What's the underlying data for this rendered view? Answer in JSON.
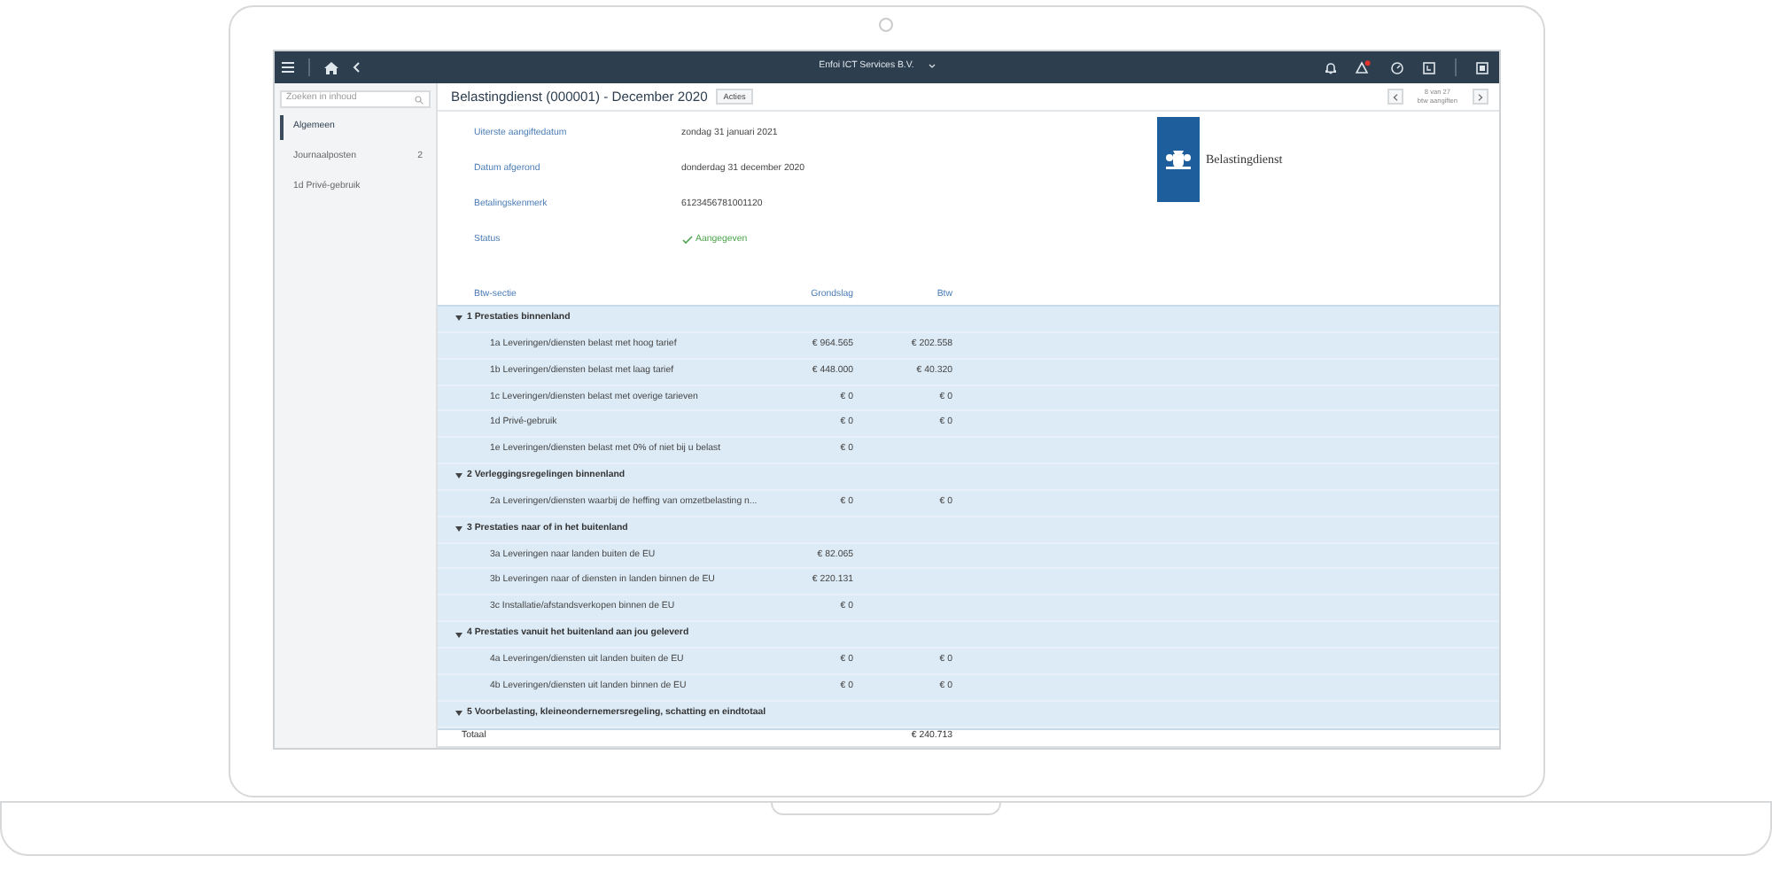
{
  "topbar": {
    "company": "Enfoi ICT Services B.V."
  },
  "sidebar": {
    "search": {
      "placeholder": "Zoeken in inhoud"
    },
    "items": [
      {
        "label": "Algemeen",
        "selected": true
      },
      {
        "label": "Journaalposten",
        "count": "2",
        "selected": false
      },
      {
        "label": "1d Privé-gebruik",
        "selected": false
      }
    ]
  },
  "header": {
    "title": "Belastingdienst (000001) - December 2020",
    "actions": "Acties",
    "pager": {
      "position": "8 van 27",
      "context": "btw aangiften"
    }
  },
  "details": [
    {
      "label": "Uiterste aangiftedatum",
      "value": "zondag 31 januari 2021",
      "kind": "text"
    },
    {
      "label": "Datum afgerond",
      "value": "donderdag 31 december 2020",
      "kind": "text"
    },
    {
      "label": "Betalingskenmerk",
      "value": "6123456781001120",
      "kind": "text"
    },
    {
      "label": "Status",
      "value": "Aangegeven",
      "kind": "status"
    }
  ],
  "logo": {
    "name": "Belastingdienst"
  },
  "table": {
    "columns": [
      "Btw-sectie",
      "Grondslag",
      "Btw"
    ],
    "groups": [
      {
        "label": "1 Prestaties binnenland",
        "expanded": true,
        "rows": [
          {
            "label": "1a Leveringen/diensten belast met hoog tarief",
            "base": "€ 964.565",
            "vat": "€ 202.558"
          },
          {
            "label": "1b Leveringen/diensten belast met laag tarief",
            "base": "€ 448.000",
            "vat": "€ 40.320"
          },
          {
            "label": "1c Leveringen/diensten belast met overige tarieven",
            "base": "€ 0",
            "vat": "€ 0"
          },
          {
            "label": "1d Privé-gebruik",
            "base": "€ 0",
            "vat": "€ 0"
          },
          {
            "label": "1e Leveringen/diensten belast met 0% of niet bij u belast",
            "base": "€ 0"
          }
        ]
      },
      {
        "label": "2 Verleggingsregelingen binnenland",
        "expanded": true,
        "rows": [
          {
            "label": "2a Leveringen/diensten waarbij de heffing van omzetbelasting n...",
            "base": "€ 0",
            "vat": "€ 0"
          }
        ]
      },
      {
        "label": "3 Prestaties naar of in het buitenland",
        "expanded": true,
        "rows": [
          {
            "label": "3a Leveringen naar landen buiten de EU",
            "base": "€ 82.065"
          },
          {
            "label": "3b Leveringen naar of diensten in landen binnen de EU",
            "base": "€ 220.131"
          },
          {
            "label": "3c Installatie/afstandsverkopen binnen de EU",
            "base": "€ 0"
          }
        ]
      },
      {
        "label": "4 Prestaties vanuit het buitenland aan jou geleverd",
        "expanded": true,
        "rows": [
          {
            "label": "4a Leveringen/diensten uit landen buiten de EU",
            "base": "€ 0",
            "vat": "€ 0"
          },
          {
            "label": "4b Leveringen/diensten uit landen binnen de EU",
            "base": "€ 0",
            "vat": "€ 0"
          }
        ]
      },
      {
        "label": "5 Voorbelasting, kleineondernemersregeling, schatting en eindtotaal",
        "expanded": true
      }
    ],
    "total": {
      "label": "Totaal",
      "vat": "€ 240.713"
    }
  }
}
